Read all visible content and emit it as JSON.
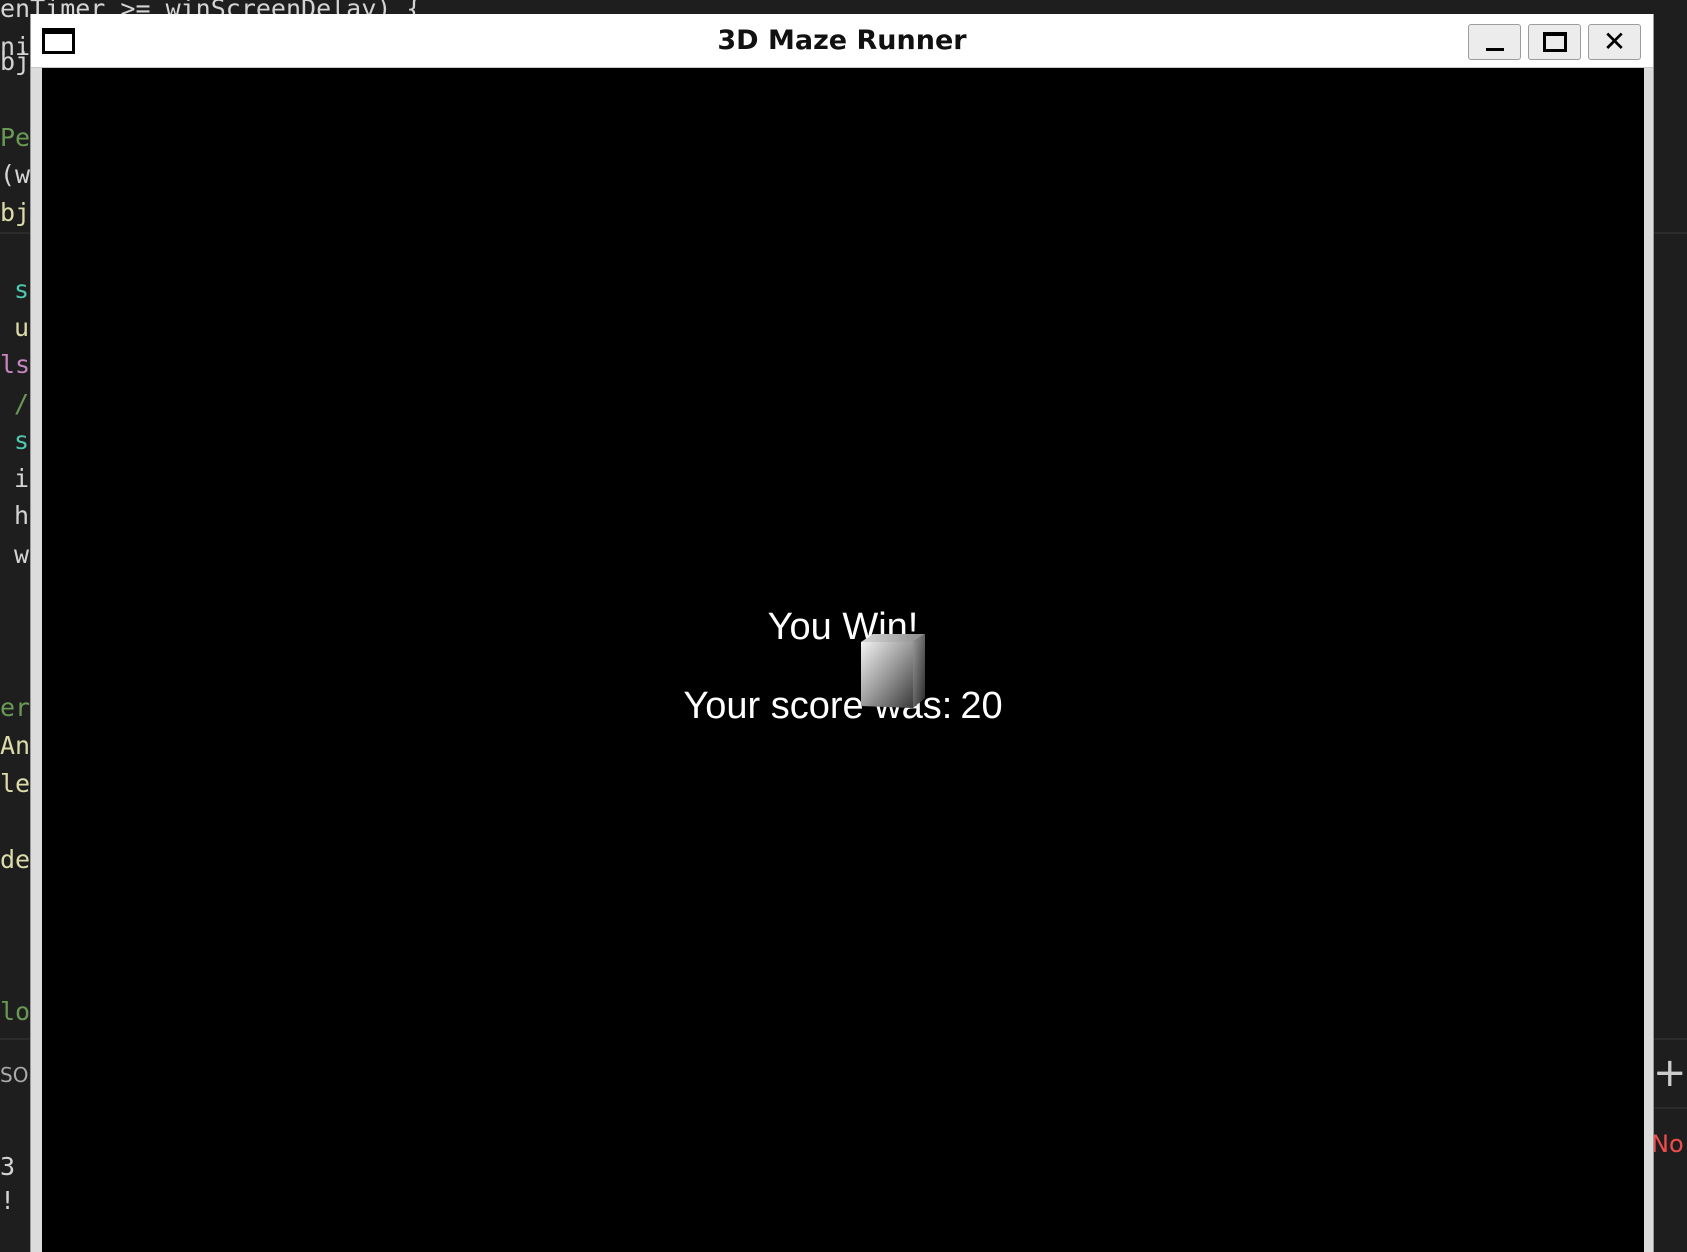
{
  "background_editor": {
    "top_line_text": "enTimer >= winScreenDelay) {",
    "line_fragments": [
      "ni",
      "bj",
      "Pe",
      "(w",
      "bj",
      "s",
      "u",
      "ls",
      "/",
      "s",
      "i",
      "h",
      "w",
      "er",
      "An",
      "le",
      "de",
      "lo",
      "SO",
      "3",
      "!"
    ],
    "right_plus": "+",
    "right_status": "No"
  },
  "window": {
    "title": "3D Maze Runner",
    "buttons": {
      "minimize_icon": "minimize-icon",
      "maximize_icon": "maximize-icon",
      "close_icon": "close-icon",
      "close_glyph": "✕"
    }
  },
  "game": {
    "win_message": "You Win!",
    "score_label": "Your score was:",
    "score_value": "20"
  },
  "colors": {
    "canvas_background": "#000000",
    "text": "#ffffff",
    "titlebar": "#ffffff"
  }
}
